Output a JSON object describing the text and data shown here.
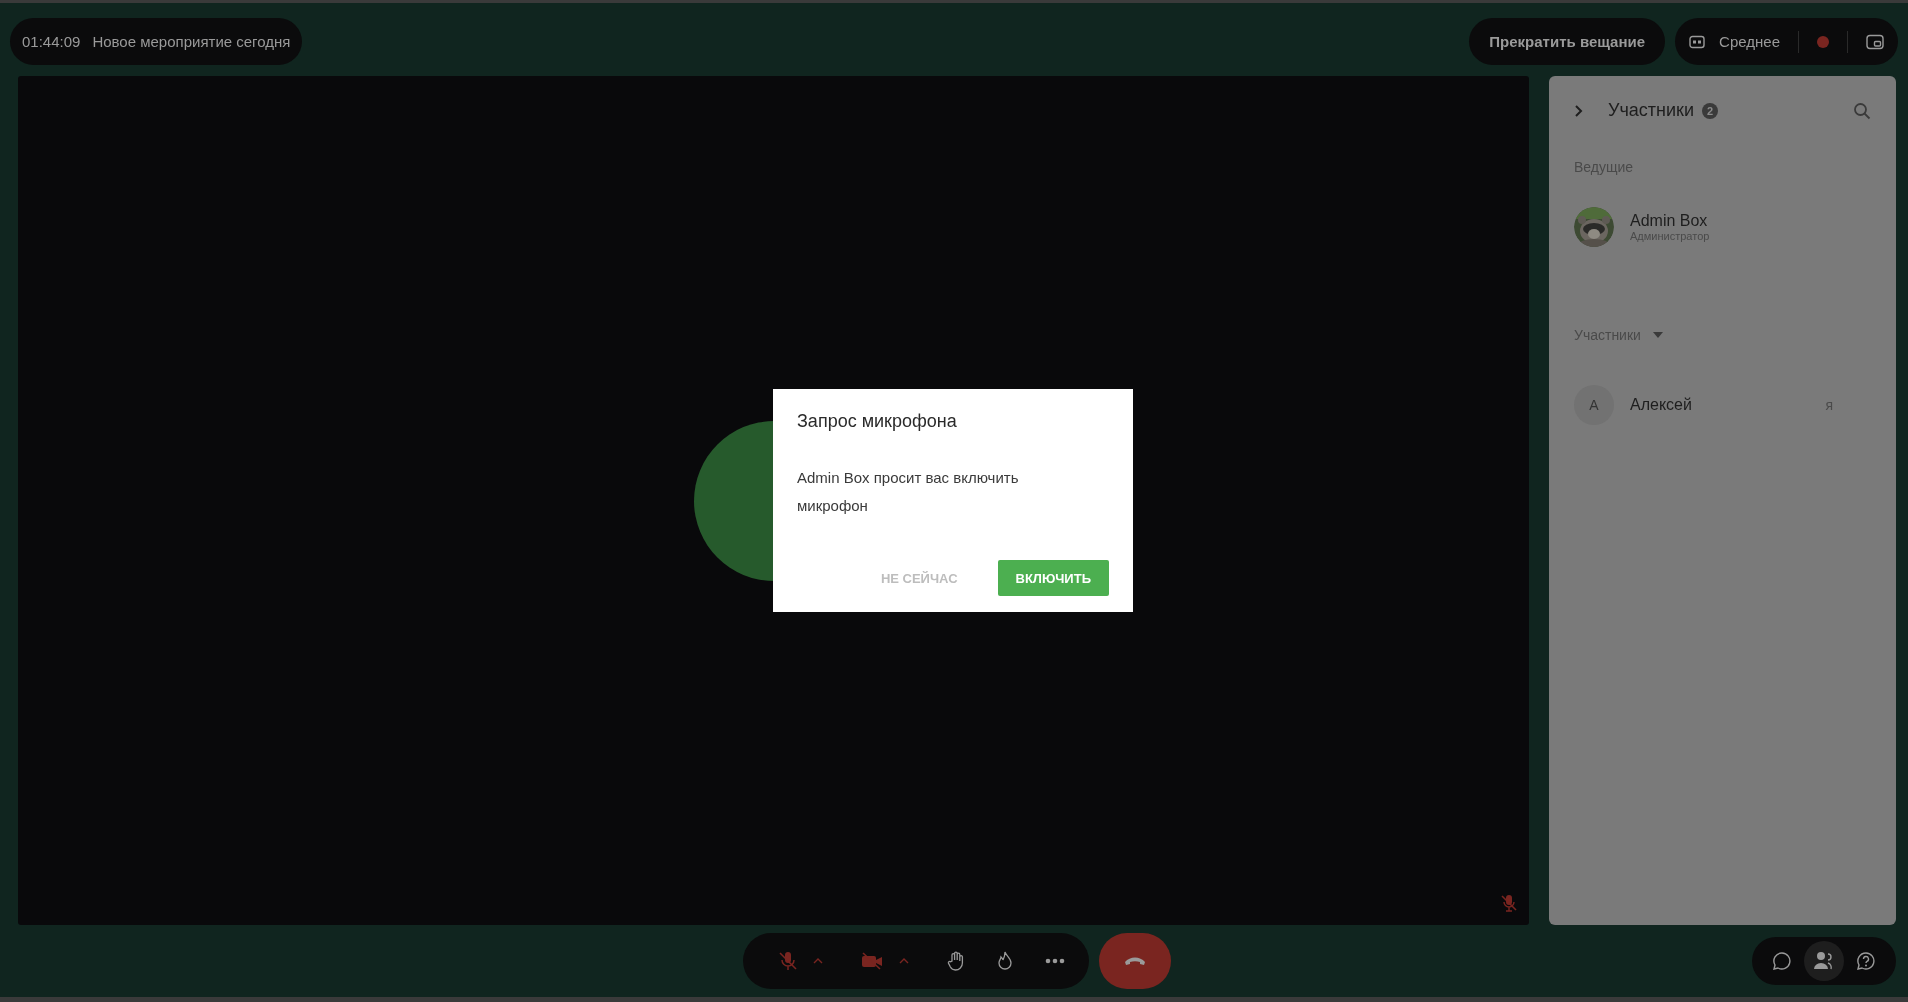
{
  "header": {
    "timer": "01:44:09",
    "title": "Новое мероприятие сегодня",
    "stop_button": "Прекратить вещание",
    "quality": "Среднее",
    "recording": true
  },
  "stage": {
    "speaker_muted": true
  },
  "dialog": {
    "title": "Запрос микрофона",
    "message": "Admin Box просит вас включить микрофон",
    "buttons": [
      {
        "label": "НЕ СЕЙЧАС",
        "kind": "text"
      },
      {
        "label": "ВКЛЮЧИТЬ",
        "kind": "primary"
      }
    ]
  },
  "sidebar": {
    "title": "Участники",
    "count": "2",
    "sections": [
      {
        "title": "Ведущие",
        "kind": "static",
        "members": [
          {
            "name": "Admin Box",
            "role": "Администратор"
          }
        ]
      },
      {
        "title": "Участники",
        "kind": "dropdown",
        "members": [
          {
            "name": "Алексей",
            "initial": "A",
            "tag": "я",
            "kind": "initial"
          }
        ]
      }
    ]
  },
  "toolbar": {
    "mic_on": false,
    "camera_on": false
  },
  "side_tabs": [
    {
      "kind": "chat",
      "selected": false
    },
    {
      "kind": "participants",
      "selected": true
    },
    {
      "kind": "help",
      "selected": false
    }
  ]
}
